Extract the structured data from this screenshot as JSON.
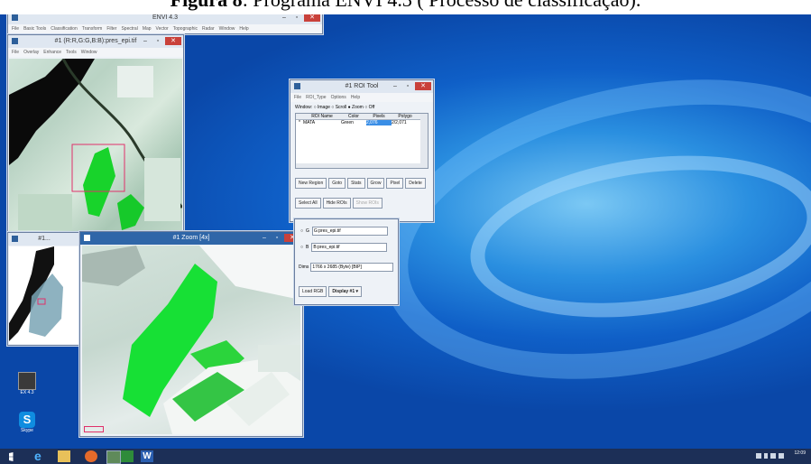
{
  "caption": {
    "bold": "Figura 8",
    "rest": ": Programa ENVI 4.3 ( Processo de classificação)."
  },
  "envi_main": {
    "title": "ENVI 4.3",
    "menu": [
      "File",
      "Basic Tools",
      "Classification",
      "Transform",
      "Filter",
      "Spectral",
      "Map",
      "Vector",
      "Topographic",
      "Radar",
      "Window",
      "Help"
    ]
  },
  "image_window": {
    "title": "#1 (R:R,G:G,B:B):pres_epi.tif",
    "menu": [
      "File",
      "Overlay",
      "Enhance",
      "Tools",
      "Window"
    ]
  },
  "scroll_window": {
    "title": "#1..."
  },
  "zoom_window": {
    "title": "#1 Zoom [4x]"
  },
  "roi_tool": {
    "title": "#1 ROI Tool",
    "menu": [
      "File",
      "ROI_Type",
      "Options",
      "Help"
    ],
    "window_label": "Window:",
    "window_options": [
      "Image",
      "Scroll",
      "Zoom",
      "Off"
    ],
    "window_selected": "Zoom",
    "columns": [
      "ROI Name",
      "Color",
      "Pixels",
      "Polygo"
    ],
    "rows": [
      {
        "marker": "*",
        "name": "MATA",
        "color": "Green",
        "pixels": "2,076",
        "polygons": "2/2,071"
      }
    ],
    "buttons_row1": [
      "New Region",
      "Goto",
      "Stats",
      "Grow",
      "Pixel",
      "Delete"
    ],
    "buttons_row2": [
      "Select All",
      "Hide ROIs",
      "Show ROIs"
    ],
    "accent": "#3a8ee6"
  },
  "file_panel": {
    "g_label": "G",
    "g_value": "G:pres_epi.tif",
    "b_label": "B",
    "b_value": "B:pres_epi.tif",
    "dims_label": "Dims",
    "dims_value": "1766 x 2685 (Byte) [BIP]",
    "load_button": "Load RGB",
    "display_button": "Display #1 ▾"
  },
  "desktop_icons": [
    {
      "label": "EX 4.3"
    },
    {
      "label": "Skype"
    }
  ],
  "taskbar": {
    "clock": "12:09"
  }
}
